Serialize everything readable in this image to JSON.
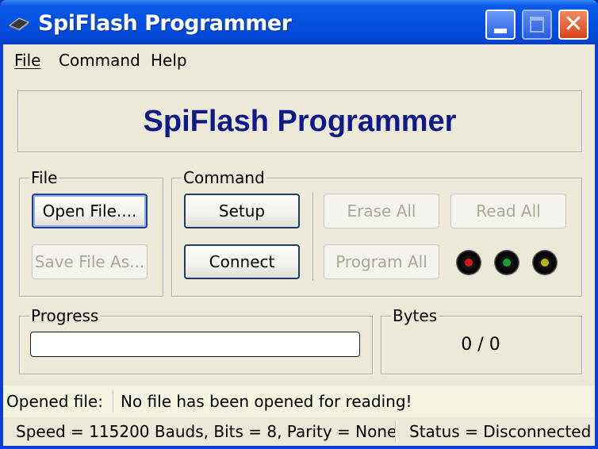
{
  "window": {
    "title": "SpiFlash Programmer",
    "close_glyph": "✕"
  },
  "menu": {
    "items": [
      {
        "label": "File",
        "mnemonic": "F"
      },
      {
        "label": "Command",
        "mnemonic": "C"
      },
      {
        "label": "Help",
        "mnemonic": "H"
      }
    ]
  },
  "banner": {
    "title": "SpiFlash Programmer"
  },
  "file_group": {
    "label": "File",
    "open_button": "Open File....",
    "save_button": "Save File As..."
  },
  "command_group": {
    "label": "Command",
    "setup_button": "Setup",
    "connect_button": "Connect",
    "erase_button": "Erase All",
    "read_button": "Read All",
    "program_button": "Program All",
    "leds": [
      {
        "name": "red",
        "color": "#d01818"
      },
      {
        "name": "green",
        "color": "#18a428"
      },
      {
        "name": "yellow",
        "color": "#b4b418"
      }
    ]
  },
  "progress_group": {
    "label": "Progress",
    "value_percent": 0
  },
  "bytes_group": {
    "label": "Bytes",
    "value": "0 / 0"
  },
  "status": {
    "opened_file_label": "Opened file:",
    "opened_file_value": "No file has been opened for reading!",
    "connection": "Speed = 115200 Bauds, Bits = 8, Parity = None",
    "state": "Status = Disconnected"
  },
  "colors": {
    "titlebar": "#0550e0",
    "banner_text": "#0f1a8a",
    "face": "#ece9d8"
  }
}
